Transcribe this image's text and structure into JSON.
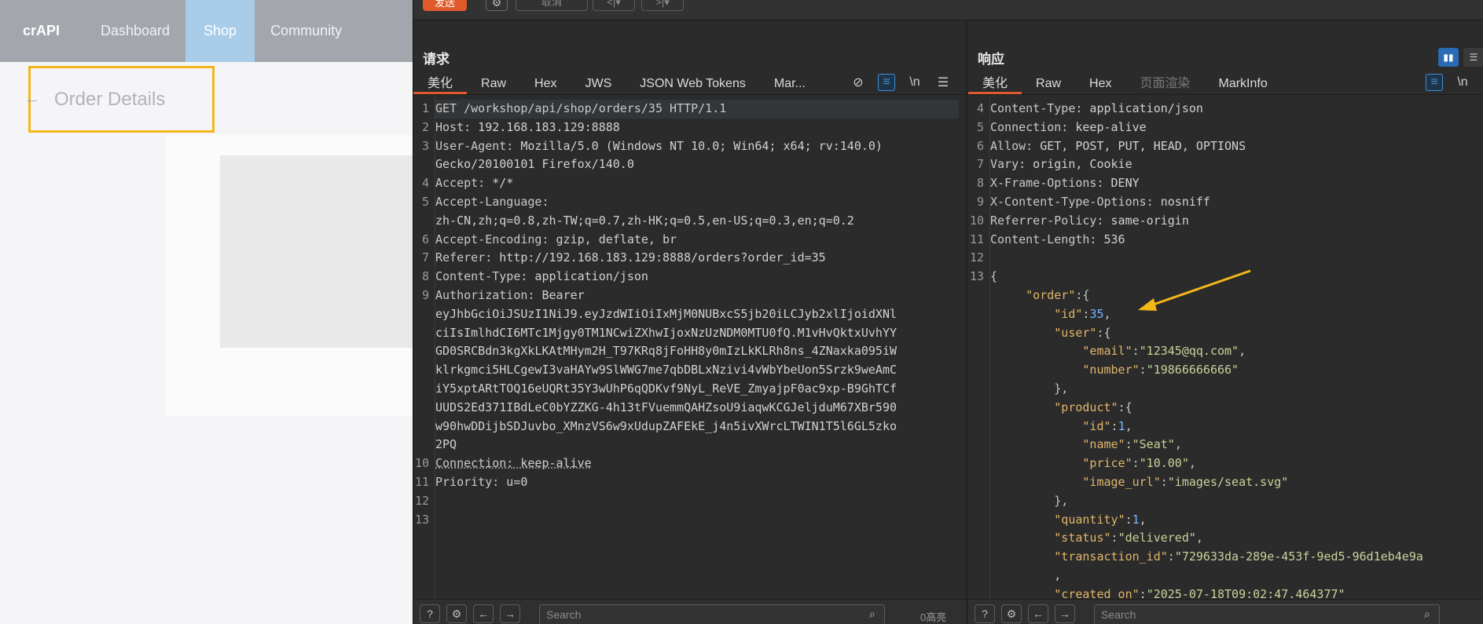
{
  "app": {
    "logo": "crAPI",
    "nav": [
      {
        "label": "Dashboard"
      },
      {
        "label": "Shop"
      },
      {
        "label": "Community"
      }
    ],
    "page_title": "Order Details",
    "back_icon": "arrow-left-icon"
  },
  "burp": {
    "toolbar": {
      "send_label": "发送",
      "cancel_label": "取消",
      "prev_label": "<|▾",
      "next_label": ">|▾"
    },
    "request": {
      "title": "请求",
      "tabs": [
        "美化",
        "Raw",
        "Hex",
        "JWS",
        "JSON Web Tokens",
        "Mar..."
      ],
      "lines": [
        {
          "n": "1",
          "name": "GET /workshop/api/shop/orders/35 HTTP/1.1",
          "value": ""
        },
        {
          "n": "2",
          "name": "Host:",
          "value": " 192.168.183.129:8888"
        },
        {
          "n": "3",
          "name": "User-Agent:",
          "value": " Mozilla/5.0 (Windows NT 10.0; Win64; x64; rv:140.0)"
        },
        {
          "n": "",
          "name": "",
          "value": "Gecko/20100101 Firefox/140.0"
        },
        {
          "n": "4",
          "name": "Accept:",
          "value": " */*"
        },
        {
          "n": "5",
          "name": "Accept-Language:",
          "value": ""
        },
        {
          "n": "",
          "name": "",
          "value": "zh-CN,zh;q=0.8,zh-TW;q=0.7,zh-HK;q=0.5,en-US;q=0.3,en;q=0.2"
        },
        {
          "n": "6",
          "name": "Accept-Encoding:",
          "value": " gzip, deflate, br"
        },
        {
          "n": "7",
          "name": "Referer:",
          "value": " http://192.168.183.129:8888/orders?order_id=35"
        },
        {
          "n": "8",
          "name": "Content-Type:",
          "value": " application/json"
        },
        {
          "n": "9",
          "name": "Authorization:",
          "value": " Bearer"
        },
        {
          "n": "",
          "name": "",
          "value": "eyJhbGciOiJSUzI1NiJ9.eyJzdWIiOiIxMjM0NUBxcS5jb20iLCJyb2xlIjoidXNl"
        },
        {
          "n": "",
          "name": "",
          "value": "ciIsImlhdCI6MTc1Mjgy0TM1NCwiZXhwIjoxNzUzNDM0MTU0fQ.M1vHvQktxUvhYY"
        },
        {
          "n": "",
          "name": "",
          "value": "GD0SRCBdn3kgXkLKAtMHym2H_T97KRq8jFoHH8y0mIzLkKLRh8ns_4ZNaxka095iW"
        },
        {
          "n": "",
          "name": "",
          "value": "klrkgmci5HLCgewI3vaHAYw9SlWWG7me7qbDBLxNzivi4vWbYbeUon5Srzk9weAmC"
        },
        {
          "n": "",
          "name": "",
          "value": "iY5xptARtTOQ16eUQRt35Y3wUhP6qQDKvf9NyL_ReVE_ZmyajpF0ac9xp-B9GhTCf"
        },
        {
          "n": "",
          "name": "",
          "value": "UUDS2Ed371IBdLeC0bYZZKG-4h13tFVuemmQAHZsoU9iaqwKCGJeljduM67XBr590"
        },
        {
          "n": "",
          "name": "",
          "value": "w90hwDDijbSDJuvbo_XMnzVS6w9xUdupZAFEkE_j4n5ivXWrcLTWIN1T5l6GL5zko"
        },
        {
          "n": "",
          "name": "",
          "value": "2PQ"
        },
        {
          "n": "10",
          "name": "Connection:",
          "value": " keep-alive"
        },
        {
          "n": "11",
          "name": "Priority:",
          "value": " u=0"
        },
        {
          "n": "12",
          "name": "",
          "value": ""
        },
        {
          "n": "13",
          "name": "",
          "value": ""
        }
      ],
      "search_placeholder": "Search",
      "match_count": "0高亮"
    },
    "response": {
      "title": "响应",
      "tabs": [
        "美化",
        "Raw",
        "Hex",
        "页面渲染",
        "MarkInfo"
      ],
      "header_lines": [
        {
          "n": "4",
          "name": "Content-Type:",
          "value": " application/json"
        },
        {
          "n": "5",
          "name": "Connection:",
          "value": " keep-alive"
        },
        {
          "n": "6",
          "name": "Allow:",
          "value": " GET, POST, PUT, HEAD, OPTIONS"
        },
        {
          "n": "7",
          "name": "Vary:",
          "value": " origin, Cookie"
        },
        {
          "n": "8",
          "name": "X-Frame-Options:",
          "value": " DENY"
        },
        {
          "n": "9",
          "name": "X-Content-Type-Options:",
          "value": " nosniff"
        },
        {
          "n": "10",
          "name": "Referrer-Policy:",
          "value": " same-origin"
        },
        {
          "n": "11",
          "name": "Content-Length:",
          "value": " 536"
        },
        {
          "n": "12",
          "name": "",
          "value": ""
        }
      ],
      "json_lines": [
        {
          "n": "13",
          "indent": 0,
          "key": "",
          "val": "{",
          "vtype": "punc"
        },
        {
          "n": "",
          "indent": 1,
          "key": "\"order\"",
          "val": ":{",
          "vtype": "punc"
        },
        {
          "n": "",
          "indent": 2,
          "key": "\"id\"",
          "val": "35",
          "vtype": "num",
          "tail": ","
        },
        {
          "n": "",
          "indent": 2,
          "key": "\"user\"",
          "val": ":{",
          "vtype": "punc"
        },
        {
          "n": "",
          "indent": 3,
          "key": "\"email\"",
          "val": "\"12345@qq.com\"",
          "vtype": "str",
          "tail": ","
        },
        {
          "n": "",
          "indent": 3,
          "key": "\"number\"",
          "val": "\"19866666666\"",
          "vtype": "str"
        },
        {
          "n": "",
          "indent": 2,
          "key": "",
          "val": "},",
          "vtype": "punc"
        },
        {
          "n": "",
          "indent": 2,
          "key": "\"product\"",
          "val": ":{",
          "vtype": "punc"
        },
        {
          "n": "",
          "indent": 3,
          "key": "\"id\"",
          "val": "1",
          "vtype": "num",
          "tail": ","
        },
        {
          "n": "",
          "indent": 3,
          "key": "\"name\"",
          "val": "\"Seat\"",
          "vtype": "str",
          "tail": ","
        },
        {
          "n": "",
          "indent": 3,
          "key": "\"price\"",
          "val": "\"10.00\"",
          "vtype": "str",
          "tail": ","
        },
        {
          "n": "",
          "indent": 3,
          "key": "\"image_url\"",
          "val": "\"images/seat.svg\"",
          "vtype": "str"
        },
        {
          "n": "",
          "indent": 2,
          "key": "",
          "val": "},",
          "vtype": "punc"
        },
        {
          "n": "",
          "indent": 2,
          "key": "\"quantity\"",
          "val": "1",
          "vtype": "num",
          "tail": ","
        },
        {
          "n": "",
          "indent": 2,
          "key": "\"status\"",
          "val": "\"delivered\"",
          "vtype": "str",
          "tail": ","
        },
        {
          "n": "",
          "indent": 2,
          "key": "\"transaction_id\"",
          "val": "\"729633da-289e-453f-9ed5-96d1eb4e9a",
          "vtype": "str"
        },
        {
          "n": "",
          "indent": 2,
          "key": "",
          "val": ",",
          "vtype": "punc"
        },
        {
          "n": "",
          "indent": 2,
          "key": "\"created_on\"",
          "val": "\"2025-07-18T09:02:47.464377\"",
          "vtype": "str"
        }
      ],
      "search_placeholder": "Search"
    }
  },
  "colors": {
    "accent_orange": "#e05a2b",
    "highlight_box": "#f4b71a",
    "annotation_arrow": "#f4b71a"
  }
}
